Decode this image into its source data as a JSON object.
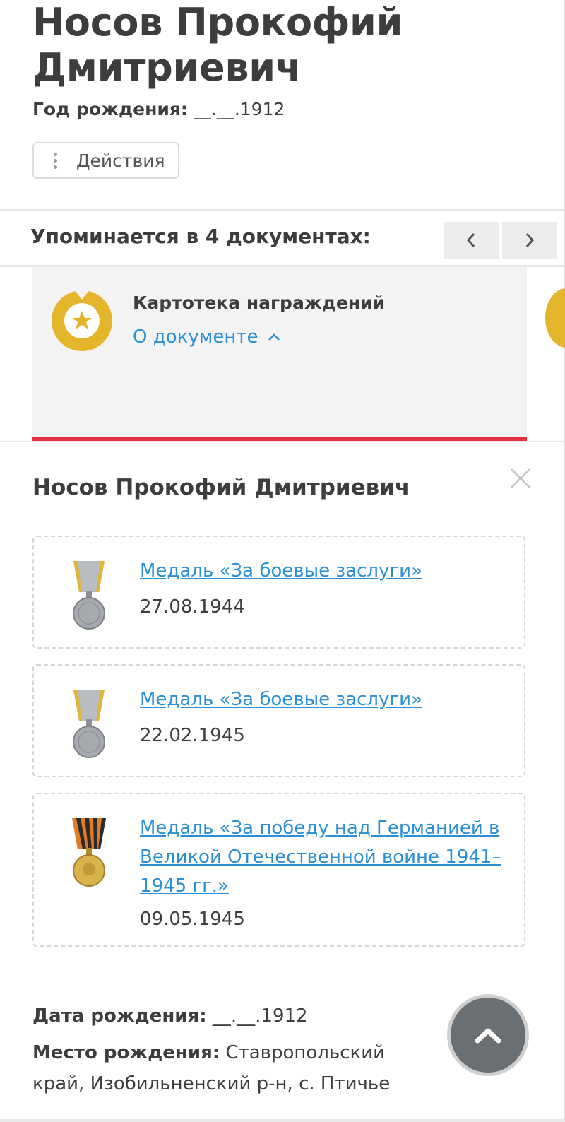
{
  "person": {
    "full_name": "Носов Прокофий Дмитриевич",
    "birth_year_label": "Год рождения:",
    "birth_year_value": "__.__.1912"
  },
  "actions": {
    "label": "Действия"
  },
  "documents": {
    "title": "Упоминается в 4 документах:",
    "prev_icon": "chevron-left-icon",
    "next_icon": "chevron-right-icon"
  },
  "card": {
    "title": "Картотека награждений",
    "about_label": "О документе",
    "icon": "medal-star-icon",
    "accent_color": "#e4b52b",
    "bottom_color": "#e3313d"
  },
  "panel": {
    "name": "Носов Прокофий Дмитриевич",
    "awards": [
      {
        "name": "Медаль «За боевые заслуги»",
        "date": "27.08.1944",
        "icon": "combat-merit-medal-icon"
      },
      {
        "name": "Медаль «За боевые заслуги»",
        "date": "22.02.1945",
        "icon": "combat-merit-medal-icon"
      },
      {
        "name": "Медаль «За победу над Германией в Великой Отечественной войне 1941–1945 гг.»",
        "date": "09.05.1945",
        "icon": "victory-medal-icon"
      }
    ]
  },
  "details": {
    "birth_date_label": "Дата рождения:",
    "birth_date_value": "__.__.1912",
    "birth_place_label": "Место рождения:",
    "birth_place_value": "Ставропольский край, Изобильненский р-н, с. Птичье"
  },
  "colors": {
    "link": "#2b8fd6",
    "text": "#3d3d3d"
  }
}
